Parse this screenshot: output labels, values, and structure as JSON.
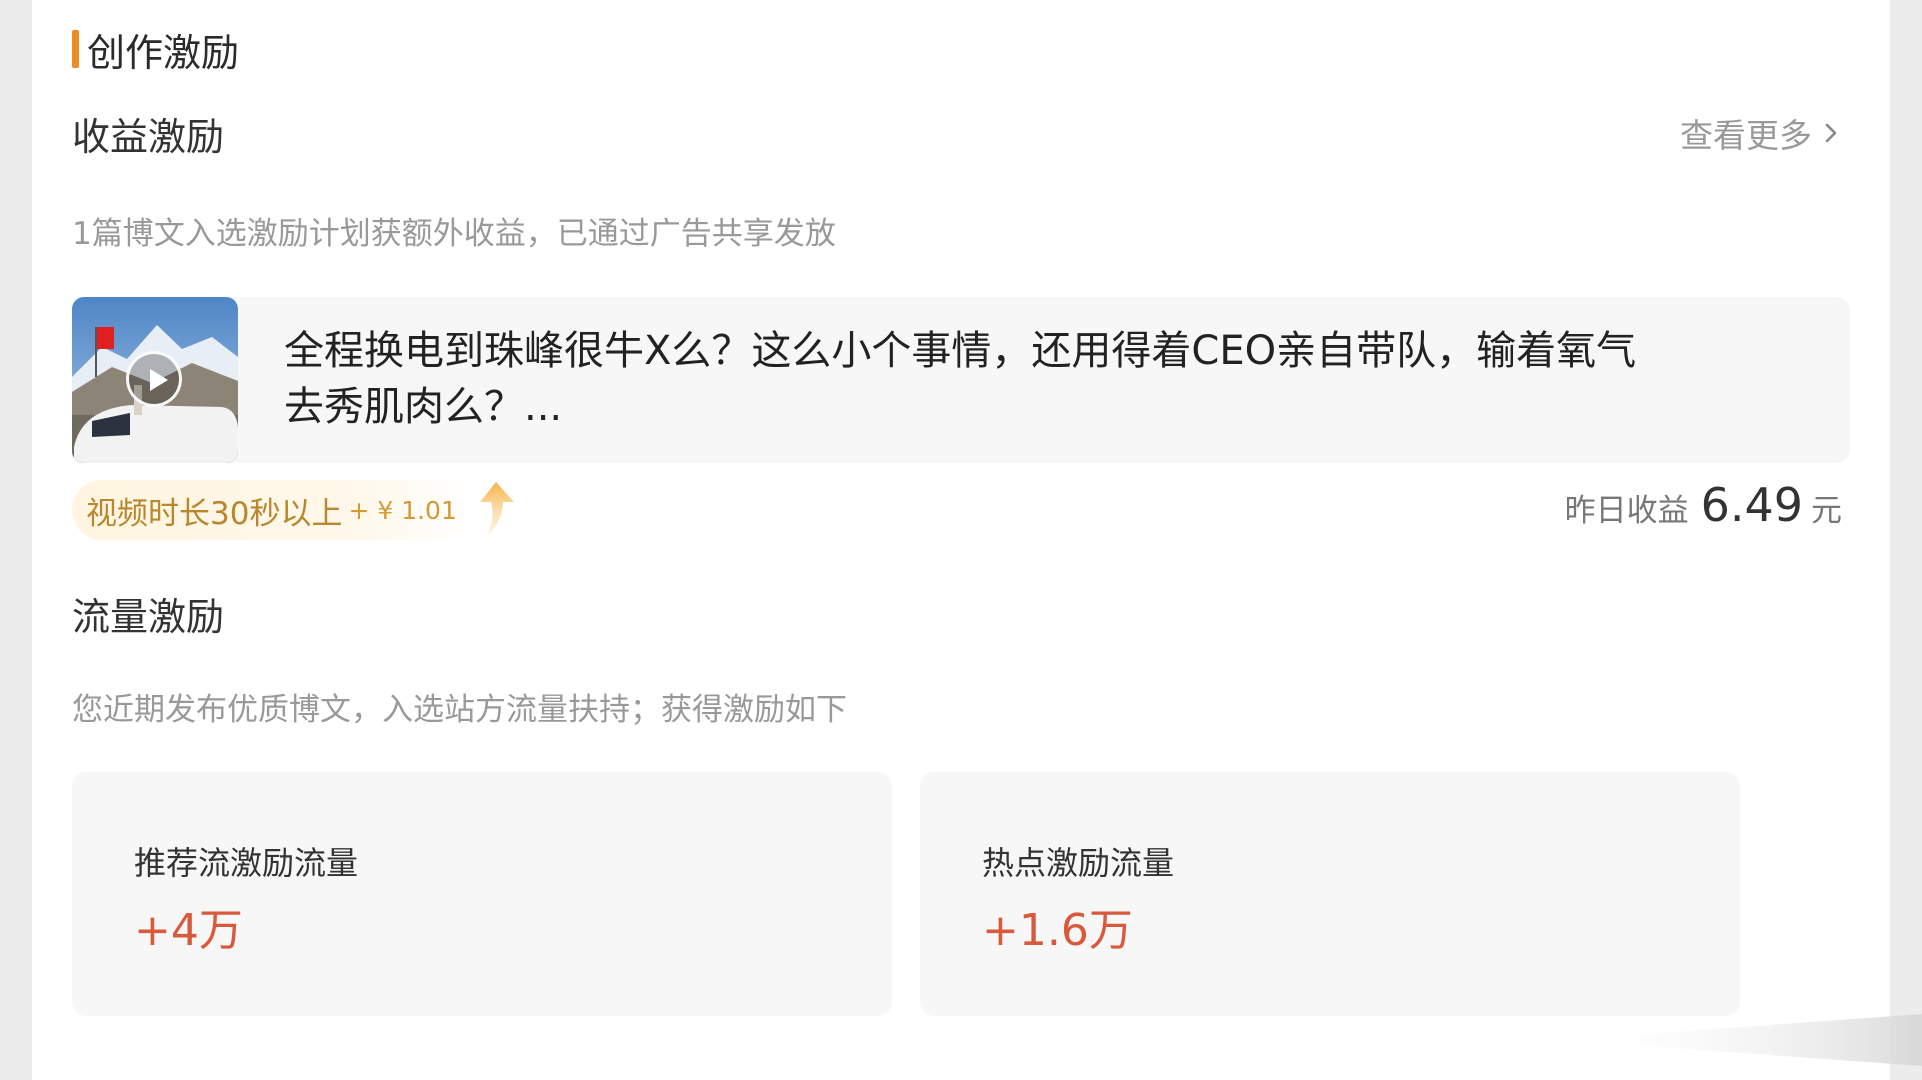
{
  "section": {
    "title": "创作激励"
  },
  "revenue": {
    "title": "收益激励",
    "more_label": "查看更多",
    "description": "1篇博文入选激励计划获额外收益，已通过广告共享发放",
    "article": {
      "text": "全程换电到珠峰很牛X么？这么小个事情，还用得着CEO亲自带队，输着氧气去秀肌肉么？..."
    },
    "tag": {
      "label": "视频时长30秒以上",
      "bonus": "+ ¥ 1.01"
    },
    "yesterday": {
      "label": "昨日收益",
      "value": "6.49",
      "unit": "元"
    }
  },
  "traffic": {
    "title": "流量激励",
    "description": "您近期发布优质博文，入选站方流量扶持；获得激励如下",
    "cards": [
      {
        "label": "推荐流激励流量",
        "value": "+4万"
      },
      {
        "label": "热点激励流量",
        "value": "+1.6万"
      }
    ]
  },
  "colors": {
    "accent": "#f08a24",
    "value_red": "#d9593c",
    "tag_text": "#b9872d",
    "muted": "#999999"
  }
}
